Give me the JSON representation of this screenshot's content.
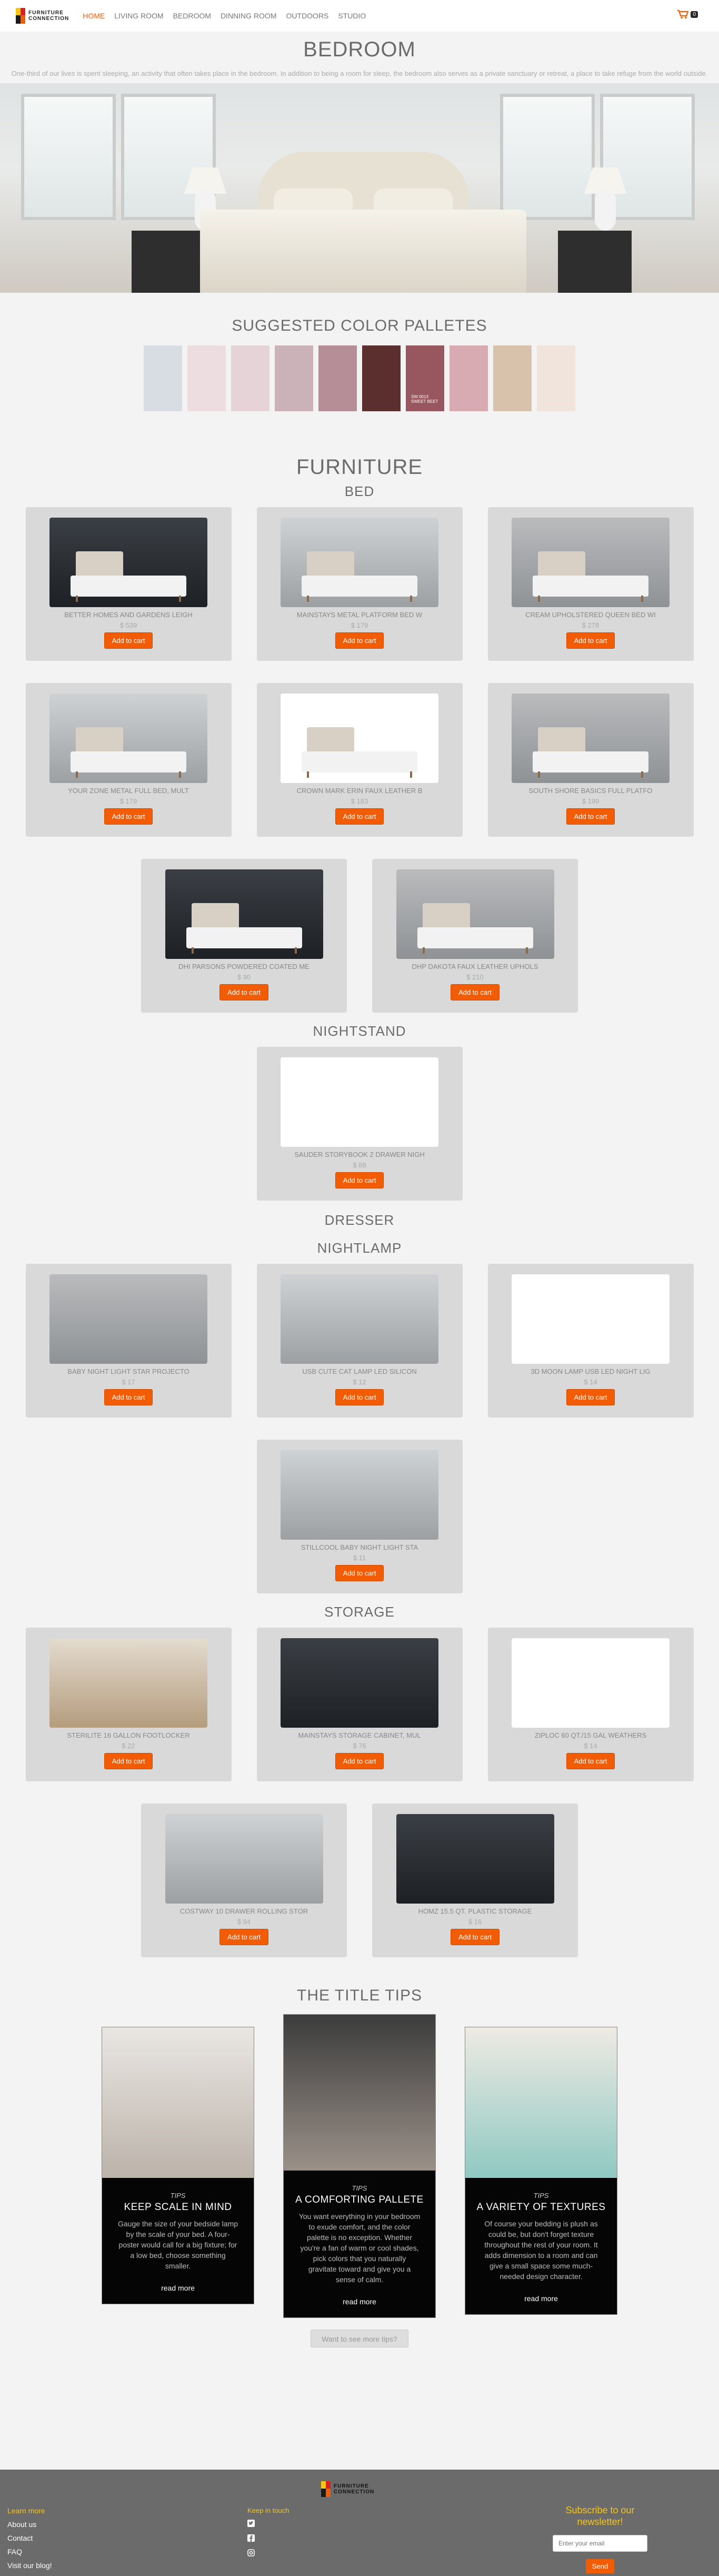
{
  "brand": {
    "line1": "FURNITURE",
    "line2": "CONNECTION"
  },
  "nav": {
    "links": [
      {
        "label": "HOME"
      },
      {
        "label": "LIVING ROOM"
      },
      {
        "label": "BEDROOM"
      },
      {
        "label": "DINNING ROOM"
      },
      {
        "label": "OUTDOORS"
      },
      {
        "label": "STUDIO"
      }
    ],
    "active_index": 0,
    "cart_count": "0"
  },
  "page": {
    "title": "BEDROOM",
    "intro": "One-third of our lives is spent sleeping, an activity that often takes place in the bedroom. In addition to being a room for sleep, the bedroom also serves as a private sanctuary or retreat, a place to take refuge from the world outside."
  },
  "palette": {
    "title": "SUGGESTED COLOR PALLETES",
    "swatches": [
      {
        "color": "#d7dde2",
        "label": ""
      },
      {
        "color": "#eddde1",
        "label": ""
      },
      {
        "color": "#e5d3d8",
        "label": ""
      },
      {
        "color": "#cbb1b8",
        "label": ""
      },
      {
        "color": "#b58e97",
        "label": ""
      },
      {
        "color": "#5c2f2f",
        "label": ""
      },
      {
        "color": "#98575e",
        "label": "SW 0013 SWEET BEET"
      },
      {
        "color": "#d8abb2",
        "label": ""
      },
      {
        "color": "#d8c2ab",
        "label": ""
      },
      {
        "color": "#f0e4dc",
        "label": ""
      }
    ]
  },
  "furniture": {
    "title": "FURNITURE",
    "add_label": "Add to cart",
    "bed": {
      "title": "BED",
      "items": [
        {
          "name": "BETTER HOMES AND GARDENS LEIGH",
          "price": "$ 539"
        },
        {
          "name": "MAINSTAYS METAL PLATFORM BED W",
          "price": "$ 179"
        },
        {
          "name": "CREAM UPHOLSTERED QUEEN BED WI",
          "price": "$ 278"
        },
        {
          "name": "YOUR ZONE METAL FULL BED, MULT",
          "price": "$ 179"
        },
        {
          "name": "CROWN MARK ERIN FAUX LEATHER B",
          "price": "$ 183"
        },
        {
          "name": "SOUTH SHORE BASICS FULL PLATFO",
          "price": "$ 199"
        },
        {
          "name": "DHI PARSONS POWDERED COATED ME",
          "price": "$ 90"
        },
        {
          "name": "DHP DAKOTA FAUX LEATHER UPHOLS",
          "price": "$ 210"
        }
      ]
    },
    "nightstand": {
      "title": "NIGHTSTAND",
      "items": [
        {
          "name": "SAUDER STORYBOOK 2 DRAWER NIGH",
          "price": "$ 88"
        }
      ]
    },
    "dresser": {
      "title": "DRESSER"
    },
    "nightlamp": {
      "title": "NIGHTLAMP",
      "items": [
        {
          "name": "BABY NIGHT LIGHT STAR PROJECTO",
          "price": "$ 17"
        },
        {
          "name": "USB CUTE CAT LAMP LED SILICON",
          "price": "$ 12"
        },
        {
          "name": "3D MOON LAMP USB LED NIGHT LIG",
          "price": "$ 14"
        },
        {
          "name": "STILLCOOL BABY NIGHT LIGHT STA",
          "price": "$ 11"
        }
      ]
    },
    "storage": {
      "title": "STORAGE",
      "items": [
        {
          "name": "STERILITE 16 GALLON FOOTLOCKER",
          "price": "$ 22"
        },
        {
          "name": "MAINSTAYS STORAGE CABINET, MUL",
          "price": "$ 76"
        },
        {
          "name": "ZIPLOC 60 QT./15 GAL WEATHERS",
          "price": "$ 14"
        },
        {
          "name": "COSTWAY 10 DRAWER ROLLING STOR",
          "price": "$ 94"
        },
        {
          "name": "HOMZ 15.5 QT. PLASTIC STORAGE",
          "price": "$ 16"
        }
      ]
    }
  },
  "tips": {
    "title": "THE TITLE TIPS",
    "label": "TIPS",
    "more_label": "read more",
    "items": [
      {
        "title": "KEEP SCALE IN MIND",
        "text": "Gauge the size of your bedside lamp by the scale of your bed. A four-poster would call for a big fixture; for a low bed, choose something smaller."
      },
      {
        "title": "A COMFORTING PALLETE",
        "text": "You want everything in your bedroom to exude comfort, and the color palette is no exception. Whether you're a fan of warm or cool shades, pick colors that you naturally gravitate toward and give you a sense of calm."
      },
      {
        "title": "A VARIETY OF TEXTURES",
        "text": "Of course your bedding is plush as could be, but don't forget texture throughout the rest of your room. It adds dimension to a room and can give a small space some much-needed design character."
      }
    ],
    "want_more": "Want to see more tips?"
  },
  "footer": {
    "learn_title": "Learn more",
    "learn_links": [
      "About us",
      "Contact",
      "FAQ",
      "Visit our blog!"
    ],
    "social_title": "Keep in touch",
    "social_icons": [
      "twitter-icon",
      "facebook-icon",
      "instagram-icon"
    ],
    "newsletter_title": "Subscribe to our newsletter!",
    "email_placeholder": "Enter your email",
    "send_label": "Send"
  }
}
